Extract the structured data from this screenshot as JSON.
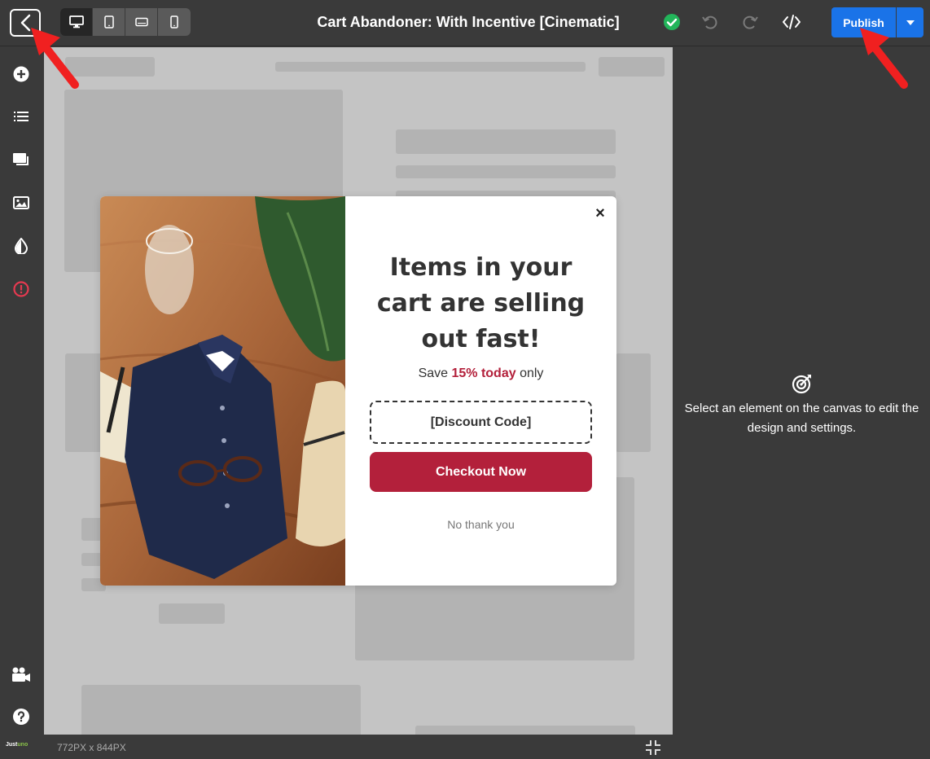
{
  "topbar": {
    "title": "Cart Abandoner: With Incentive [Cinematic]",
    "publish_label": "Publish",
    "devices": [
      "desktop",
      "tablet",
      "tablet-landscape",
      "mobile"
    ],
    "active_device": "desktop"
  },
  "sidebar": {
    "items": [
      "add-icon",
      "list-icon",
      "layers-icon",
      "image-icon",
      "contrast-icon",
      "alert-icon"
    ],
    "bottom_items": [
      "video-camera-icon",
      "help-icon"
    ],
    "brand_prefix": "Just",
    "brand_suffix": "uno"
  },
  "canvas": {
    "dimensions": "772PX x 844PX"
  },
  "popup": {
    "close_label": "×",
    "headline": "Items in your cart are selling out fast!",
    "sub_prefix": "Save ",
    "sub_highlight": "15% today",
    "sub_suffix": " only",
    "discount_code": "[Discount Code]",
    "checkout_label": "Checkout Now",
    "decline_label": "No thank you",
    "accent_color": "#b3203b"
  },
  "right_panel": {
    "message": "Select an element on the canvas to edit the design and settings."
  }
}
